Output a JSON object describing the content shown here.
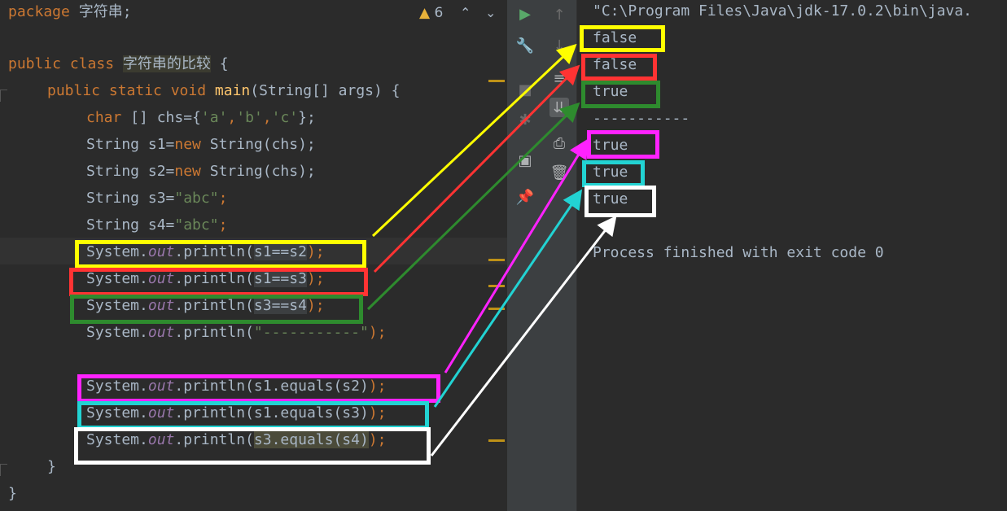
{
  "editor": {
    "package_kw": "package",
    "package_name": "字符串;",
    "warning_count": "6",
    "class_kw": "public class",
    "class_name": "字符串的比较",
    "brace_open": " {",
    "main_sig": {
      "mods": "public static void",
      "name": "main",
      "params": "(String[] args) {"
    },
    "lines": [
      {
        "pre": "char",
        "rest": " [] chs={",
        "s1": "'a'",
        "c1": ",",
        "s2": "'b'",
        "c2": ",",
        "s3": "'c'",
        "end": "};"
      },
      {
        "text1": "String s1=",
        "kw": "new",
        "text2": " String(chs);"
      },
      {
        "text1": "String s2=",
        "kw": "new",
        "text2": " String(chs);"
      },
      {
        "text1": "String s3=",
        "str": "\"abc\"",
        "text2": ";"
      },
      {
        "text1": "String s4=",
        "str": "\"abc\"",
        "text2": ";"
      }
    ],
    "printlns": [
      {
        "head": "System.",
        "out": "out",
        "mid": ".println(",
        "arg": "s1==s2",
        "tail": ");"
      },
      {
        "head": "System.",
        "out": "out",
        "mid": ".println(",
        "arg": "s1==s3",
        "tail": ");"
      },
      {
        "head": "System.",
        "out": "out",
        "mid": ".println(",
        "arg": "s3==s4",
        "tail": ");"
      },
      {
        "head": "System.",
        "out": "out",
        "mid": ".println(",
        "arg": "\"-----------\"",
        "tail": ");"
      },
      {
        "head": "System.",
        "out": "out",
        "mid": ".println(",
        "arg": "s1.equals(s2)",
        "tail": ");"
      },
      {
        "head": "System.",
        "out": "out",
        "mid": ".println(",
        "arg": "s1.equals(s3)",
        "tail": ");"
      },
      {
        "head": "System.",
        "out": "out",
        "mid": ".println(",
        "arg": "s3.equals(s4)",
        "tail": ");"
      }
    ],
    "close_method": "}",
    "close_class": "}"
  },
  "console": {
    "command": "\"C:\\Program Files\\Java\\jdk-17.0.2\\bin\\java.",
    "outputs": [
      "false",
      "false",
      "true",
      "-----------",
      "true",
      "true",
      "true"
    ],
    "exit": "Process finished with exit code 0"
  },
  "colors": {
    "yellow": "#ffff00",
    "red": "#ff3333",
    "green": "#2e8b2e",
    "magenta": "#ff22ff",
    "cyan": "#22d3d3",
    "white": "#ffffff"
  },
  "toolbar_icons": [
    "run-icon",
    "wrench-icon",
    "stop-icon",
    "up-arrow-icon",
    "down-arrow-icon",
    "soft-wrap-icon",
    "scroll-to-end-icon",
    "print-icon",
    "trash-icon",
    "pin-icon",
    "layout-icon",
    "bug-icon"
  ]
}
